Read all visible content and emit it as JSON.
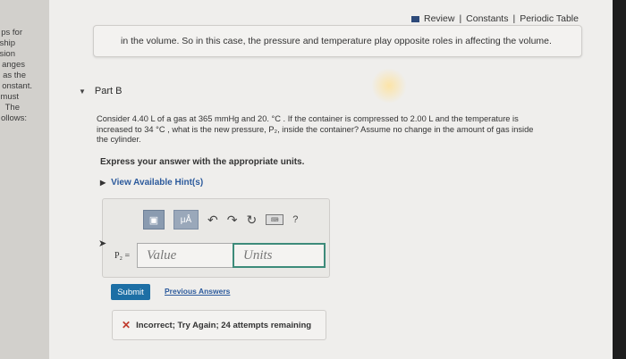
{
  "sidebar": {
    "lines": [
      "ps for",
      "ship",
      "sion",
      "anges",
      "as the",
      "onstant.",
      "must",
      "The",
      "ollows:"
    ]
  },
  "header": {
    "review": "Review",
    "constants": "Constants",
    "periodic": "Periodic Table",
    "sep": "|"
  },
  "explanation": "in the volume. So in this case, the pressure and temperature play opposite roles in affecting the volume.",
  "part": {
    "label": "Part B"
  },
  "question": {
    "line1": "Consider 4.40 L of a gas at 365 mmHg and 20. °C . If the container is compressed to 2.00 L and the temperature is",
    "line2": "increased to 34 °C , what is the new pressure, P₂, inside the container? Assume no change in the amount of gas inside",
    "line3": "the cylinder."
  },
  "instruction": "Express your answer with the appropriate units.",
  "hint": {
    "label": "View Available Hint(s)"
  },
  "answer": {
    "variable": "P₂ =",
    "value_placeholder": "Value",
    "units_placeholder": "Units",
    "toolbar": {
      "template": "▣",
      "mu": "μÅ",
      "undo": "↶",
      "redo": "↷",
      "reset": "↻",
      "keyboard": "⌨",
      "help": "?"
    }
  },
  "actions": {
    "submit": "Submit",
    "previous": "Previous Answers"
  },
  "feedback": {
    "icon": "✕",
    "text": "Incorrect; Try Again; 24 attempts remaining"
  },
  "colors": {
    "submit": "#1d6fa5",
    "link": "#2c5a9c",
    "error": "#c0392b",
    "units_border": "#3d8b7a"
  }
}
